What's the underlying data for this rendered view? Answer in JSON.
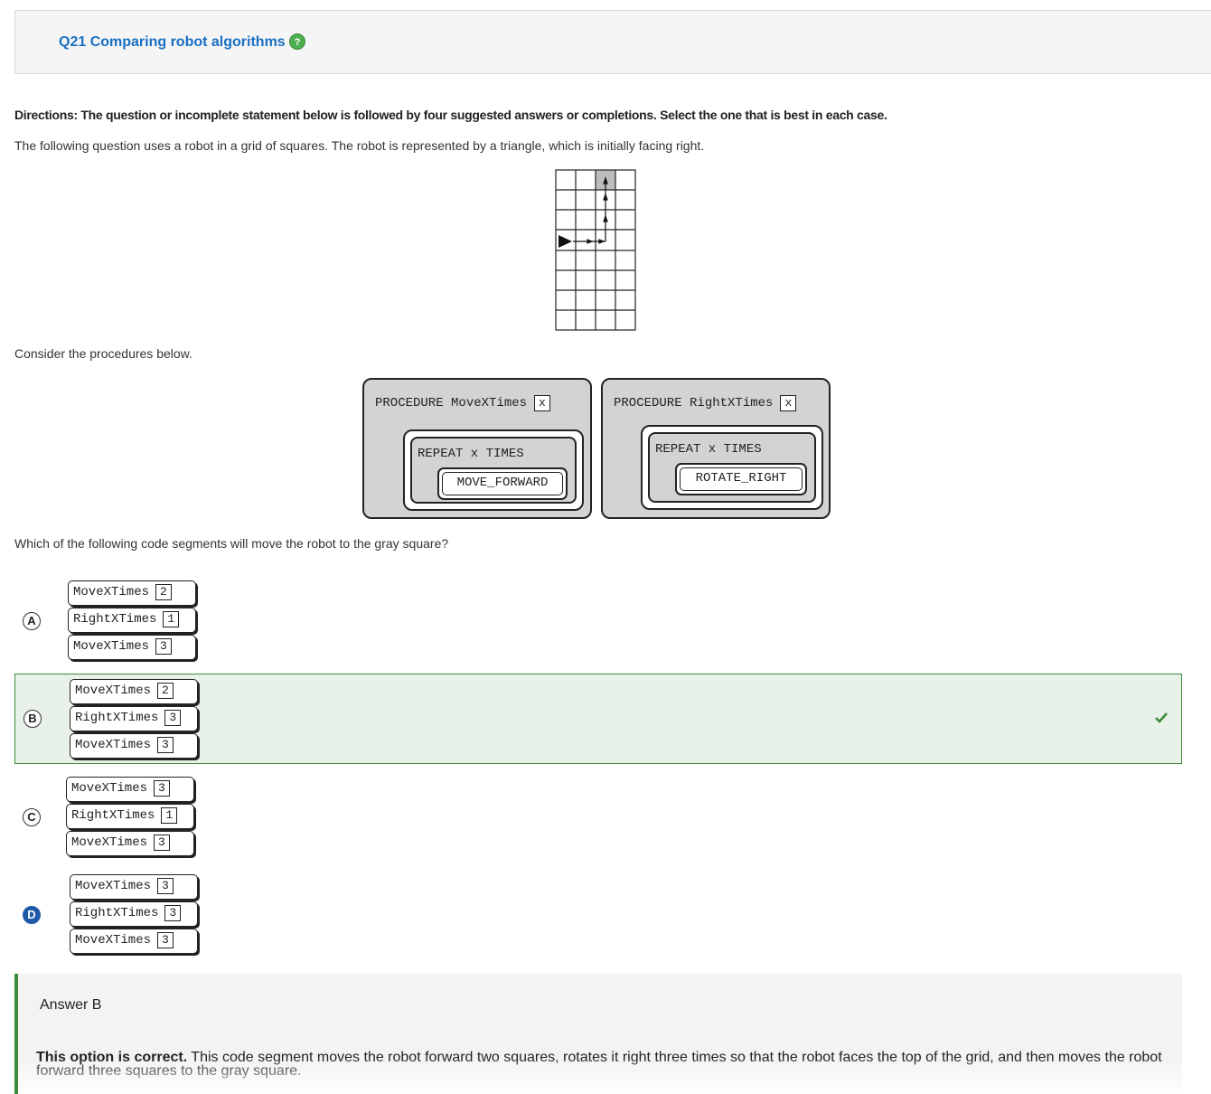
{
  "header": {
    "title": "Q21 Comparing robot algorithms",
    "help_icon": "?"
  },
  "directions": "Directions: The question or incomplete statement below is followed by four suggested answers or completions. Select the one that is best in each case.",
  "intro": "The following question uses a robot in a grid of squares. The robot is represented by a triangle, which is initially facing right.",
  "consider": "Consider the procedures below.",
  "procedures": [
    {
      "header": "PROCEDURE MoveXTimes",
      "param": "x",
      "repeat": "REPEAT x TIMES",
      "command": "MOVE_FORWARD"
    },
    {
      "header": "PROCEDURE RightXTimes",
      "param": "x",
      "repeat": "REPEAT x TIMES",
      "command": "ROTATE_RIGHT"
    }
  ],
  "question": "Which of the following code segments will move the robot to the gray square?",
  "options": [
    {
      "letter": "A",
      "lines": [
        {
          "cmd": "MoveXTimes",
          "arg": "2"
        },
        {
          "cmd": "RightXTimes",
          "arg": "1"
        },
        {
          "cmd": "MoveXTimes",
          "arg": "3"
        }
      ]
    },
    {
      "letter": "B",
      "lines": [
        {
          "cmd": "MoveXTimes",
          "arg": "2"
        },
        {
          "cmd": "RightXTimes",
          "arg": "3"
        },
        {
          "cmd": "MoveXTimes",
          "arg": "3"
        }
      ]
    },
    {
      "letter": "C",
      "lines": [
        {
          "cmd": "MoveXTimes",
          "arg": "3"
        },
        {
          "cmd": "RightXTimes",
          "arg": "1"
        },
        {
          "cmd": "MoveXTimes",
          "arg": "3"
        }
      ]
    },
    {
      "letter": "D",
      "lines": [
        {
          "cmd": "MoveXTimes",
          "arg": "3"
        },
        {
          "cmd": "RightXTimes",
          "arg": "3"
        },
        {
          "cmd": "MoveXTimes",
          "arg": "3"
        }
      ]
    }
  ],
  "correct_icon": "check-icon",
  "answer": {
    "title": "Answer B",
    "lead": "This option is correct.",
    "body": " This code segment moves the robot forward two squares, rotates it right three times so that the robot faces the top of the grid, and then moves the robot forward three squares to the gray square."
  },
  "colors": {
    "accent": "#1a6fc4",
    "correct": "#3c8a3c",
    "selected": "#1f5aa8"
  }
}
